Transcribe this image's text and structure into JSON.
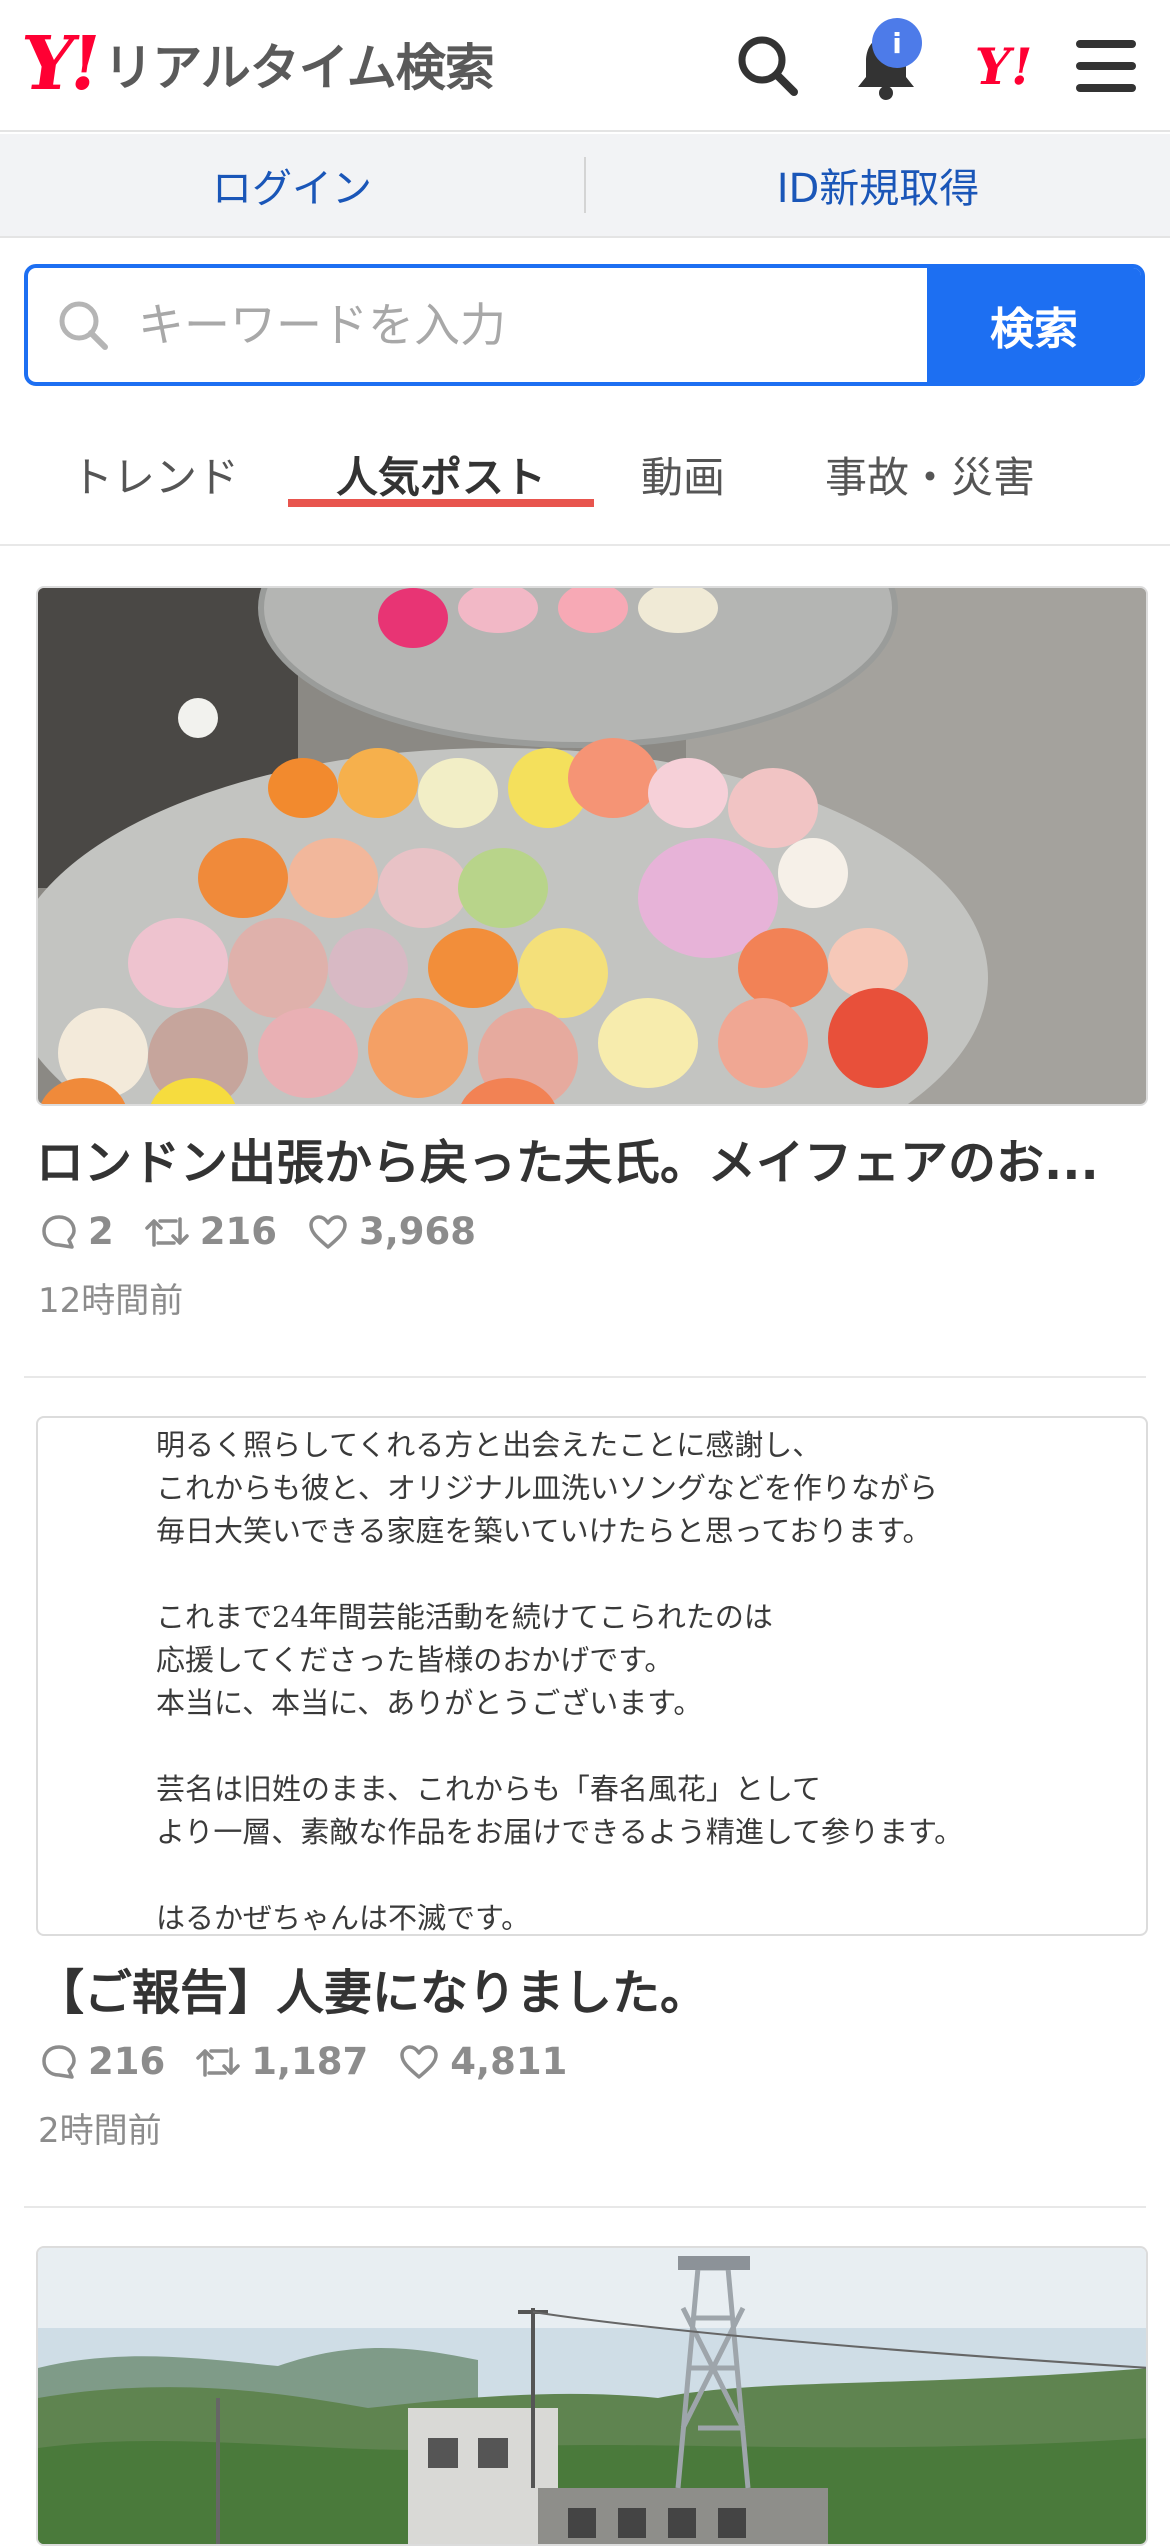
{
  "header": {
    "logo_mark": "Y!",
    "logo_text": "リアルタイム検索",
    "notification_badge": "i",
    "yahoo_mark": "Y!"
  },
  "account": {
    "login_label": "ログイン",
    "signup_label": "ID新規取得"
  },
  "search": {
    "placeholder": "キーワードを入力",
    "button_label": "検索"
  },
  "tabs": [
    {
      "label": "トレンド",
      "active": false
    },
    {
      "label": "人気ポスト",
      "active": true
    },
    {
      "label": "動画",
      "active": false
    },
    {
      "label": "事故・災害",
      "active": false
    }
  ],
  "posts": [
    {
      "title": "ロンドン出張から戻った夫氏。メイフェアのお...",
      "replies": "2",
      "reposts": "216",
      "likes": "3,968",
      "time": "12時間前",
      "image": "flowers"
    },
    {
      "title": "【ご報告】人妻になりました。",
      "replies": "216",
      "reposts": "1,187",
      "likes": "4,811",
      "time": "2時間前",
      "image": "document",
      "image_text": "明るく照らしてくれる方と出会えたことに感謝し、\nこれからも彼と、オリジナル皿洗いソングなどを作りながら\n毎日大笑いできる家庭を築いていけたらと思っております。\n\nこれまで24年間芸能活動を続けてこられたのは\n応援してくださった皆様のおかげです。\n本当に、本当に、ありがとうございます。\n\n芸名は旧姓のまま、これからも「春名風花」として\nより一層、素敵な作品をお届けできるよう精進して参ります。\n\nはるかぜちゃんは不滅です。"
    },
    {
      "image": "landscape"
    }
  ],
  "colors": {
    "brand_red": "#ff0033",
    "accent_blue": "#1d6ff2",
    "tab_underline": "#e8554e",
    "link_blue": "#1a56b8"
  }
}
